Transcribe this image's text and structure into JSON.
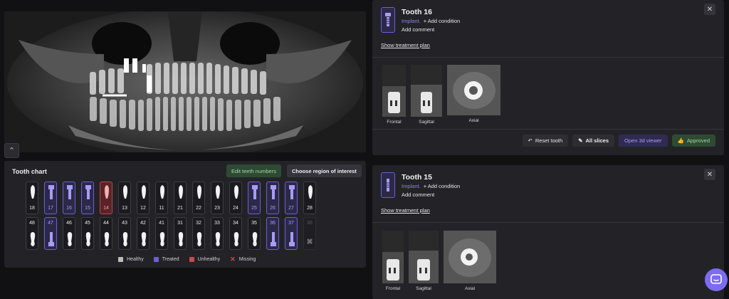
{
  "colors": {
    "healthy": "#bdbdbd",
    "treated": "#6b5fd6",
    "unhealthy": "#c94a4a",
    "missing": "#c94a4a",
    "approve": "#9fd5a7",
    "accent": "#7b6cf0"
  },
  "tooth_chart": {
    "title": "Tooth chart",
    "edit_button": "Edit teeth numbers",
    "roi_button": "Choose region of interest",
    "upper": [
      {
        "num": "18",
        "status": "healthy"
      },
      {
        "num": "17",
        "status": "treated"
      },
      {
        "num": "16",
        "status": "treated"
      },
      {
        "num": "15",
        "status": "treated"
      },
      {
        "num": "14",
        "status": "unhealthy"
      },
      {
        "num": "13",
        "status": "healthy"
      },
      {
        "num": "12",
        "status": "healthy"
      },
      {
        "num": "11",
        "status": "healthy"
      },
      {
        "num": "21",
        "status": "healthy"
      },
      {
        "num": "22",
        "status": "healthy"
      },
      {
        "num": "23",
        "status": "healthy"
      },
      {
        "num": "24",
        "status": "healthy"
      },
      {
        "num": "25",
        "status": "treated"
      },
      {
        "num": "26",
        "status": "treated"
      },
      {
        "num": "27",
        "status": "treated"
      },
      {
        "num": "28",
        "status": "healthy"
      }
    ],
    "lower": [
      {
        "num": "48",
        "status": "healthy"
      },
      {
        "num": "47",
        "status": "treated"
      },
      {
        "num": "46",
        "status": "healthy"
      },
      {
        "num": "45",
        "status": "healthy"
      },
      {
        "num": "44",
        "status": "healthy"
      },
      {
        "num": "43",
        "status": "healthy"
      },
      {
        "num": "42",
        "status": "healthy"
      },
      {
        "num": "41",
        "status": "healthy"
      },
      {
        "num": "31",
        "status": "healthy"
      },
      {
        "num": "32",
        "status": "healthy"
      },
      {
        "num": "33",
        "status": "healthy"
      },
      {
        "num": "34",
        "status": "healthy"
      },
      {
        "num": "35",
        "status": "healthy"
      },
      {
        "num": "36",
        "status": "treated"
      },
      {
        "num": "37",
        "status": "treated"
      },
      {
        "num": "38",
        "status": "missing"
      }
    ],
    "legend": {
      "healthy": "Healthy",
      "treated": "Treated",
      "unhealthy": "Unhealthy",
      "missing": "Missing"
    }
  },
  "cards": [
    {
      "title": "Tooth 16",
      "condition": "Implant.",
      "add_condition": "+ Add condition",
      "add_comment": "Add comment",
      "plan_link": "Show treatment plan",
      "slices": {
        "frontal": "Frontal",
        "sagittal": "Sagittal",
        "axial": "Axial"
      },
      "actions": {
        "reset": "Reset tooth",
        "all_slices": "All slices",
        "open3d": "Open 3d viewer",
        "approved": "Approved"
      }
    },
    {
      "title": "Tooth 15",
      "condition": "Implant.",
      "add_condition": "+ Add condition",
      "add_comment": "Add comment",
      "plan_link": "Show treatment plan",
      "slices": {
        "frontal": "Frontal",
        "sagittal": "Sagittal",
        "axial": "Axial"
      }
    }
  ]
}
